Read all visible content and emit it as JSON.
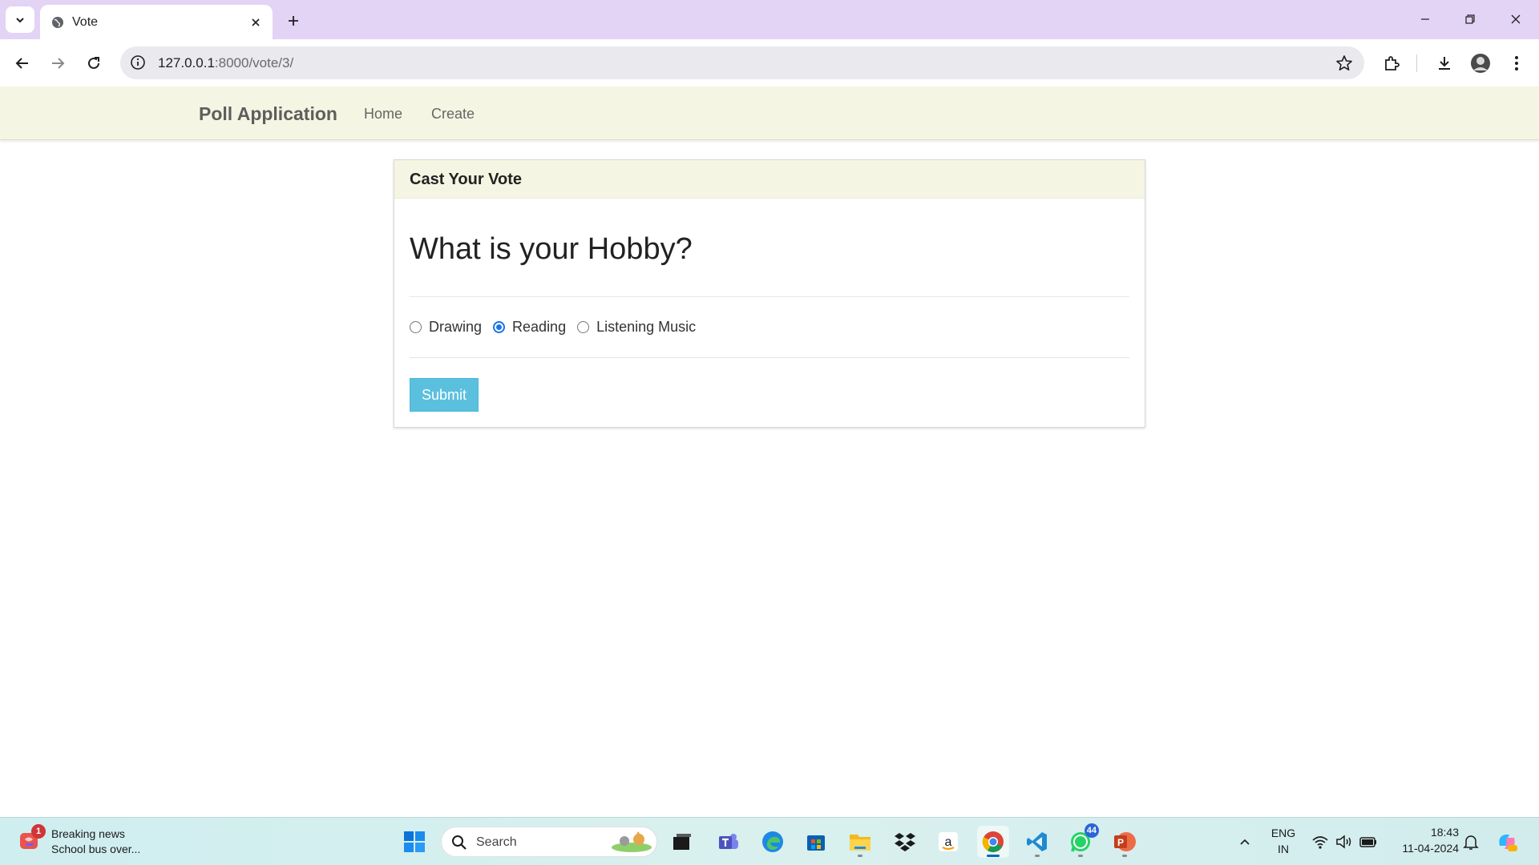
{
  "browser": {
    "tab_title": "Vote",
    "url_host": "127.0.0.1",
    "url_path": ":8000/vote/3/"
  },
  "navbar": {
    "brand": "Poll Application",
    "links": [
      "Home",
      "Create"
    ]
  },
  "card": {
    "header": "Cast Your Vote",
    "question": "What is your Hobby?",
    "choices": [
      {
        "label": "Drawing",
        "checked": false
      },
      {
        "label": "Reading",
        "checked": true
      },
      {
        "label": "Listening Music",
        "checked": false
      }
    ],
    "submit_label": "Submit"
  },
  "taskbar": {
    "news_badge": "1",
    "news_title": "Breaking news",
    "news_subtitle": "School bus over...",
    "search_placeholder": "Search",
    "whatsapp_badge": "44",
    "lang_line1": "ENG",
    "lang_line2": "IN",
    "time": "18:43",
    "date": "11-04-2024"
  },
  "colors": {
    "accent": "#5bc0de",
    "navbar_bg": "#f5f5e3",
    "tabstrip_bg": "#e3d3f5"
  }
}
